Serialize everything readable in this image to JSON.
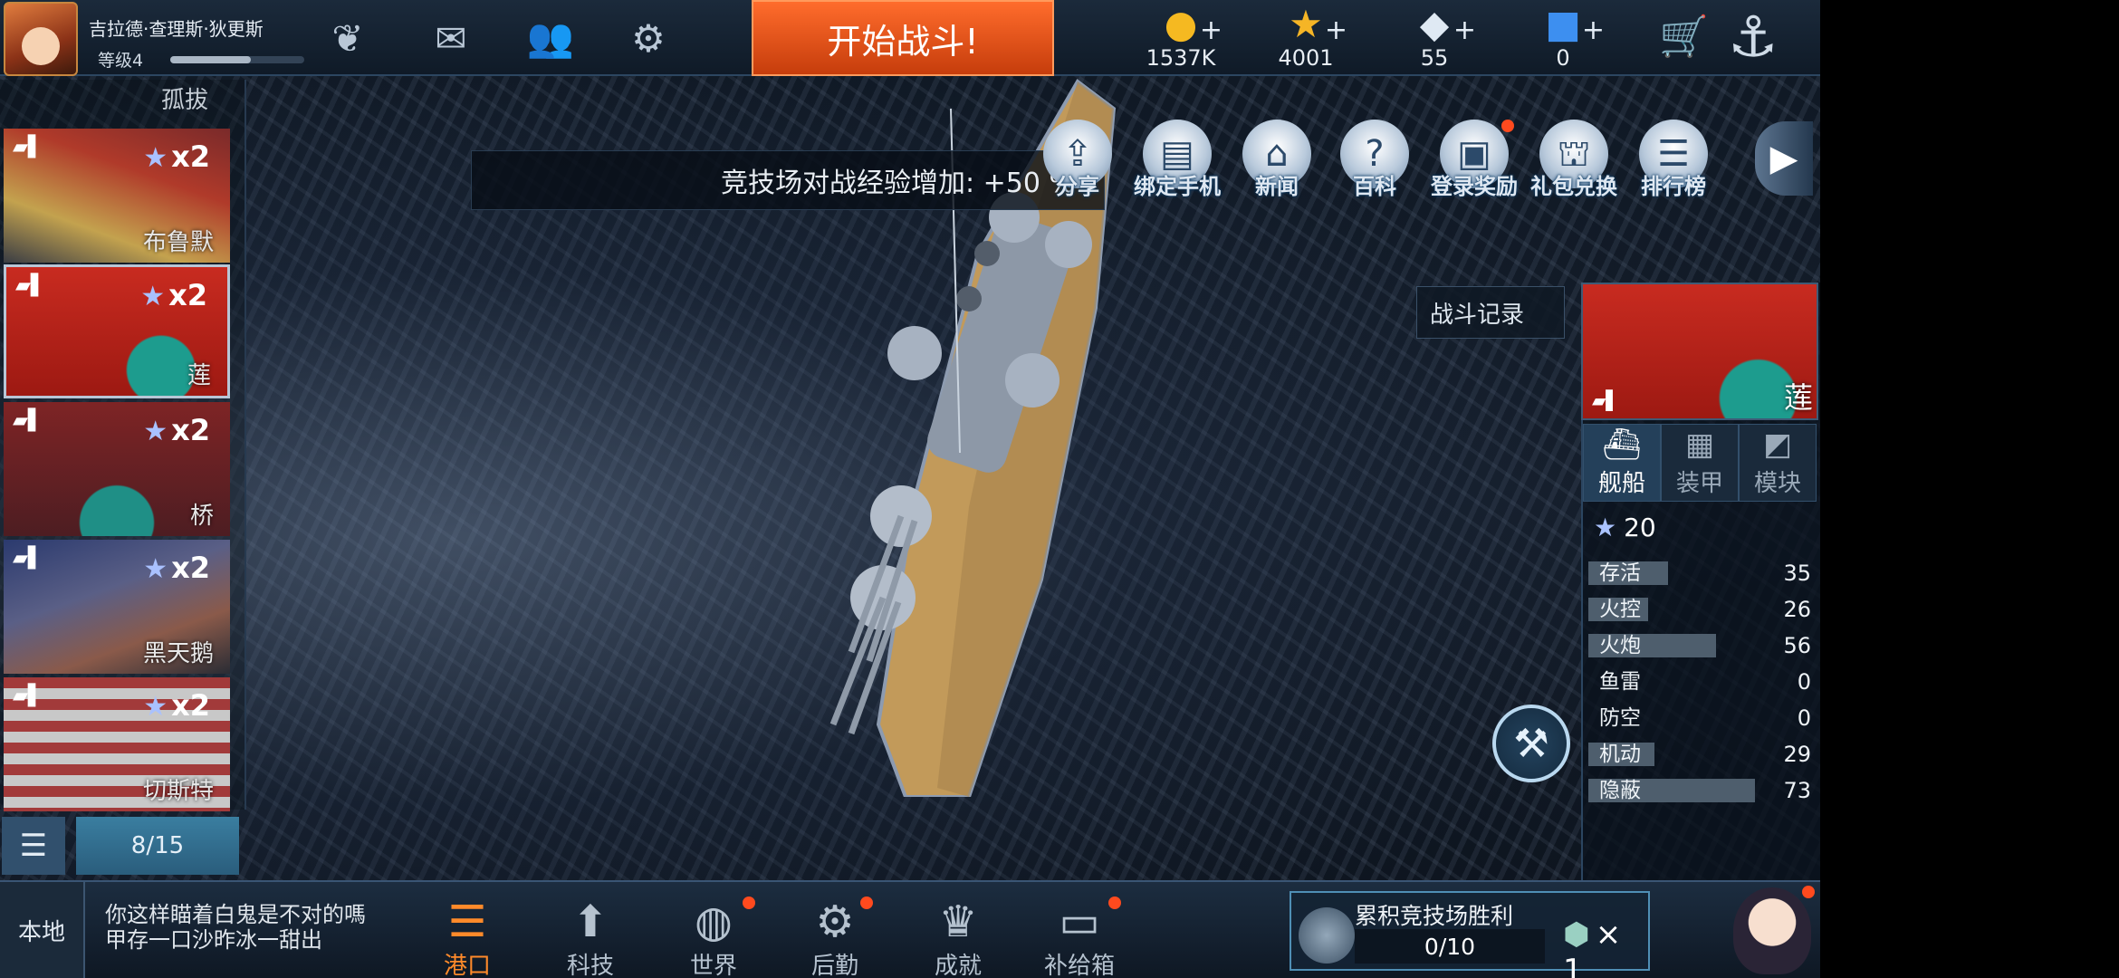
{
  "player": {
    "name": "吉拉德·查理斯·狄更斯",
    "level": "等级4",
    "xp_fraction": 0.6
  },
  "topbar": {
    "start_battle": "开始战斗!",
    "resources": [
      {
        "name": "gold",
        "icon": "gold-coin-icon",
        "value": "1537K"
      },
      {
        "name": "star",
        "icon": "star-icon",
        "value": "4001"
      },
      {
        "name": "diamond",
        "icon": "diamond-icon",
        "value": "55"
      },
      {
        "name": "cube",
        "icon": "blue-cube-icon",
        "value": "0"
      }
    ]
  },
  "banner": "竞技场对战经验增加: +50 %",
  "menu": [
    {
      "label": "分享",
      "icon": "share-icon",
      "dot": false
    },
    {
      "label": "绑定手机",
      "icon": "phone-bind-icon",
      "dot": false
    },
    {
      "label": "新闻",
      "icon": "news-icon",
      "dot": false
    },
    {
      "label": "百科",
      "icon": "encyclopedia-icon",
      "dot": false
    },
    {
      "label": "登录奖励",
      "icon": "login-reward-icon",
      "dot": true
    },
    {
      "label": "礼包兑换",
      "icon": "gift-redeem-icon",
      "dot": false
    },
    {
      "label": "排行榜",
      "icon": "leaderboard-icon",
      "dot": false
    }
  ],
  "fleet": {
    "partial_top_name": "孤拔",
    "ships": [
      {
        "multiplier": "x2",
        "name": "布鲁默",
        "selected": false
      },
      {
        "multiplier": "x2",
        "name": "莲",
        "selected": true
      },
      {
        "multiplier": "x2",
        "name": "桥",
        "selected": false
      },
      {
        "multiplier": "x2",
        "name": "黑天鹅",
        "selected": false
      },
      {
        "multiplier": "x2",
        "name": "切斯特",
        "selected": false
      }
    ],
    "page": "8/15"
  },
  "battle_record": "战斗记录",
  "ship_panel": {
    "name": "莲",
    "tabs": [
      {
        "label": "舰船",
        "icon": "ship-icon",
        "active": true
      },
      {
        "label": "装甲",
        "icon": "armor-icon",
        "active": false
      },
      {
        "label": "模块",
        "icon": "module-icon",
        "active": false
      }
    ],
    "rating": "20",
    "stats": [
      {
        "label": "存活",
        "value": 35
      },
      {
        "label": "火控",
        "value": 26
      },
      {
        "label": "火炮",
        "value": 56
      },
      {
        "label": "鱼雷",
        "value": 0
      },
      {
        "label": "防空",
        "value": 0
      },
      {
        "label": "机动",
        "value": 29
      },
      {
        "label": "隐蔽",
        "value": 73
      }
    ]
  },
  "bottom": {
    "local": "本地",
    "chat": "你这样瞄着白鬼是不对的嗎 甲存一口沙昨冰一甜出",
    "nav": [
      {
        "label": "港口",
        "icon": "harbor-icon",
        "active": true,
        "dot": false
      },
      {
        "label": "科技",
        "icon": "tech-icon",
        "active": false,
        "dot": false
      },
      {
        "label": "世界",
        "icon": "globe-icon",
        "active": false,
        "dot": true
      },
      {
        "label": "后勤",
        "icon": "logistics-icon",
        "active": false,
        "dot": true
      },
      {
        "label": "成就",
        "icon": "achievement-icon",
        "active": false,
        "dot": false
      },
      {
        "label": "补给箱",
        "icon": "supply-box-icon",
        "active": false,
        "dot": true
      }
    ],
    "arena": {
      "title": "累积竞技场胜利",
      "progress": "0/10",
      "reward": "× 1"
    }
  }
}
